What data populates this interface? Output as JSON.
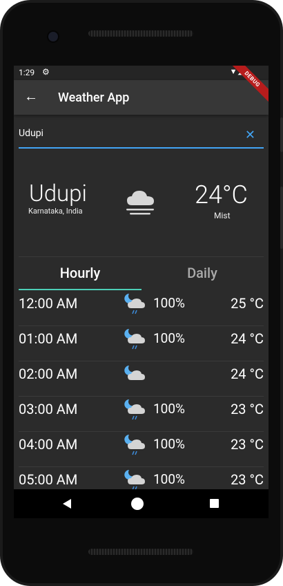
{
  "status_bar": {
    "time": "1:29",
    "debug_label": "DEBUG"
  },
  "app_bar": {
    "title": "Weather App"
  },
  "search": {
    "value": "Udupi"
  },
  "current": {
    "city": "Udupi",
    "region": "Karnataka, India",
    "temperature": "24°C",
    "condition": "Mist",
    "icon": "mist-cloud-icon"
  },
  "tabs": [
    {
      "label": "Hourly",
      "active": true
    },
    {
      "label": "Daily",
      "active": false
    }
  ],
  "hourly": [
    {
      "time": "12:00 AM",
      "icon": "night-rain-icon",
      "precip": "100%",
      "temp": "25 °C"
    },
    {
      "time": "01:00 AM",
      "icon": "night-rain-icon",
      "precip": "100%",
      "temp": "24 °C"
    },
    {
      "time": "02:00 AM",
      "icon": "night-cloud-icon",
      "precip": "",
      "temp": "24 °C"
    },
    {
      "time": "03:00 AM",
      "icon": "night-rain-icon",
      "precip": "100%",
      "temp": "23 °C"
    },
    {
      "time": "04:00 AM",
      "icon": "night-rain-icon",
      "precip": "100%",
      "temp": "23 °C"
    },
    {
      "time": "05:00 AM",
      "icon": "night-rain-icon",
      "precip": "100%",
      "temp": "23 °C"
    }
  ],
  "colors": {
    "accent_blue": "#42a5f5",
    "tab_indicator": "#4dd0b8",
    "background": "#2b2b2b",
    "app_bar": "#373737"
  }
}
